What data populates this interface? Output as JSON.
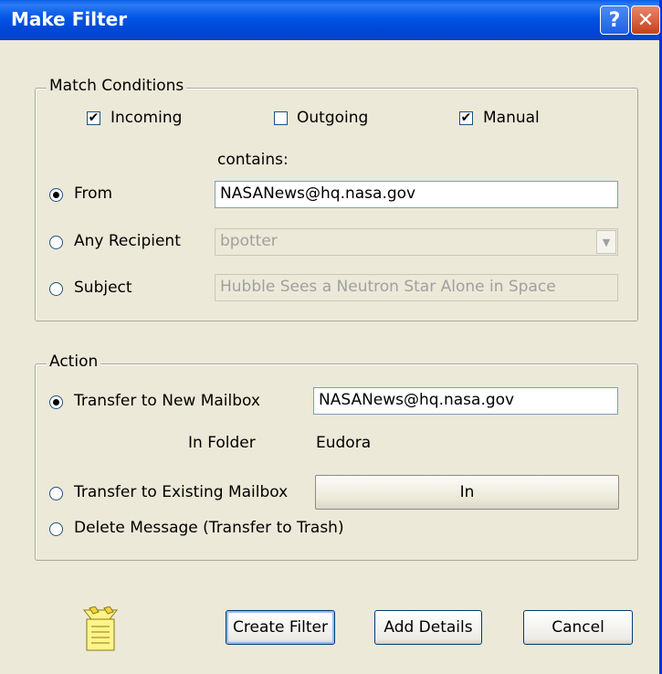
{
  "window": {
    "title": "Make Filter"
  },
  "match": {
    "legend": "Match Conditions",
    "incoming": {
      "label": "Incoming",
      "checked": true
    },
    "outgoing": {
      "label": "Outgoing",
      "checked": false
    },
    "manual": {
      "label": "Manual",
      "checked": true
    },
    "contains_label": "contains:",
    "from": {
      "label": "From",
      "selected": true,
      "value": "NASANews@hq.nasa.gov"
    },
    "any_recipient": {
      "label": "Any Recipient",
      "selected": false,
      "value": "bpotter"
    },
    "subject": {
      "label": "Subject",
      "selected": false,
      "value": "Hubble Sees a Neutron Star Alone in Space"
    }
  },
  "action": {
    "legend": "Action",
    "transfer_new": {
      "label": "Transfer to New Mailbox",
      "selected": true,
      "value": "NASANews@hq.nasa.gov"
    },
    "in_folder_label": "In Folder",
    "in_folder_value": "Eudora",
    "transfer_existing": {
      "label": "Transfer to Existing Mailbox",
      "selected": false,
      "button": "In"
    },
    "delete": {
      "label": "Delete Message (Transfer to Trash)",
      "selected": false
    }
  },
  "buttons": {
    "create": "Create Filter",
    "details": "Add Details",
    "cancel": "Cancel"
  },
  "icons": {
    "help": "help-icon",
    "close": "close-icon",
    "filter": "filter-icon"
  }
}
